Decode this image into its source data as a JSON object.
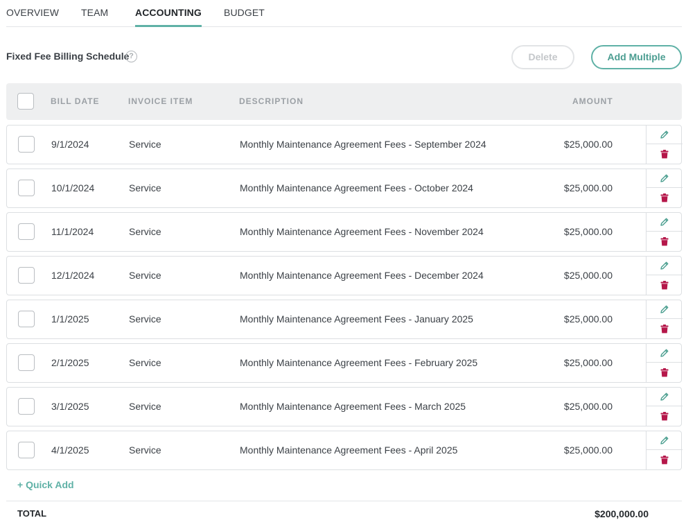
{
  "tabs": [
    {
      "label": "OVERVIEW",
      "active": false
    },
    {
      "label": "TEAM",
      "active": false
    },
    {
      "label": "ACCOUNTING",
      "active": true
    },
    {
      "label": "BUDGET",
      "active": false
    }
  ],
  "section": {
    "title": "Fixed Fee Billing Schedule",
    "help_icon": "?",
    "delete_label": "Delete",
    "add_multiple_label": "Add Multiple"
  },
  "table": {
    "headers": {
      "bill_date": "BILL DATE",
      "invoice_item": "INVOICE ITEM",
      "description": "DESCRIPTION",
      "amount": "AMOUNT"
    },
    "rows": [
      {
        "bill_date": "9/1/2024",
        "invoice_item": "Service",
        "description": "Monthly Maintenance Agreement Fees - September 2024",
        "amount": "$25,000.00"
      },
      {
        "bill_date": "10/1/2024",
        "invoice_item": "Service",
        "description": "Monthly Maintenance Agreement Fees - October 2024",
        "amount": "$25,000.00"
      },
      {
        "bill_date": "11/1/2024",
        "invoice_item": "Service",
        "description": "Monthly Maintenance Agreement Fees - November 2024",
        "amount": "$25,000.00"
      },
      {
        "bill_date": "12/1/2024",
        "invoice_item": "Service",
        "description": "Monthly Maintenance Agreement Fees - December 2024",
        "amount": "$25,000.00"
      },
      {
        "bill_date": "1/1/2025",
        "invoice_item": "Service",
        "description": "Monthly Maintenance Agreement Fees - January 2025",
        "amount": "$25,000.00"
      },
      {
        "bill_date": "2/1/2025",
        "invoice_item": "Service",
        "description": "Monthly Maintenance Agreement Fees - February 2025",
        "amount": "$25,000.00"
      },
      {
        "bill_date": "3/1/2025",
        "invoice_item": "Service",
        "description": "Monthly Maintenance Agreement Fees - March 2025",
        "amount": "$25,000.00"
      },
      {
        "bill_date": "4/1/2025",
        "invoice_item": "Service",
        "description": "Monthly Maintenance Agreement Fees - April 2025",
        "amount": "$25,000.00"
      }
    ]
  },
  "footer": {
    "quick_add_label": "+ Quick Add",
    "total_label": "TOTAL",
    "total_value": "$200,000.00"
  },
  "colors": {
    "accent": "#5fb1a6",
    "edit_icon": "#4a9e8f",
    "delete_icon": "#b5174a"
  },
  "icons": {
    "row_edit": "pencil-icon",
    "row_delete": "trash-icon",
    "help": "question-circle-icon"
  }
}
